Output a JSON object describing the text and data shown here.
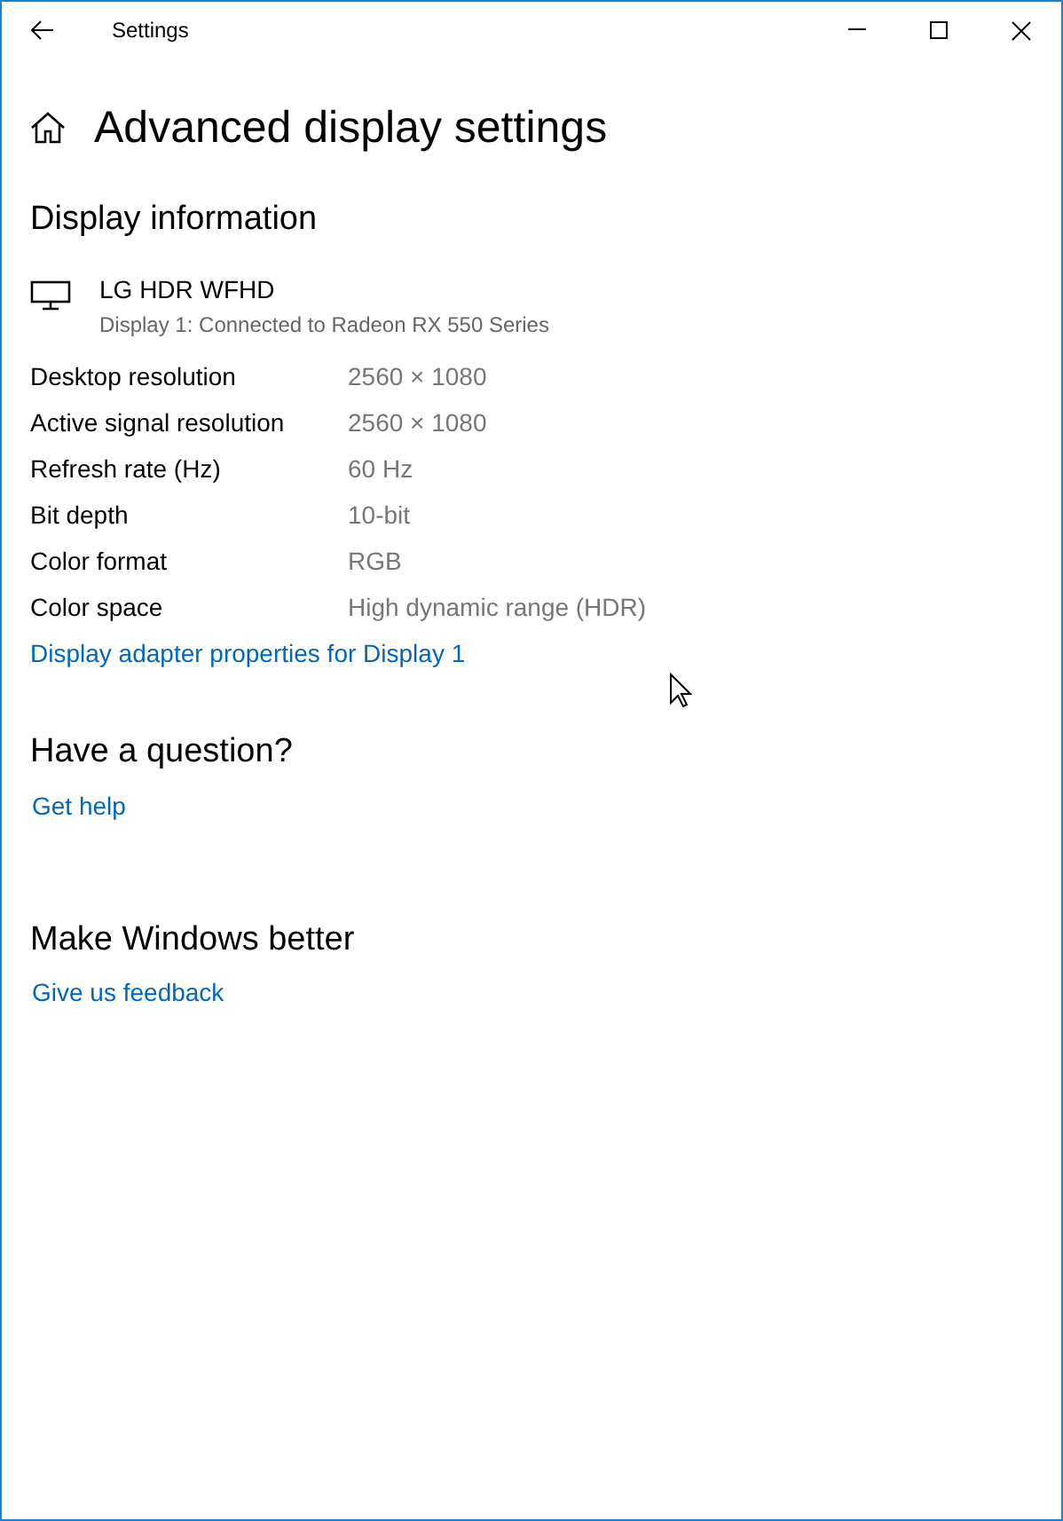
{
  "window": {
    "title": "Settings"
  },
  "page_title": "Advanced display settings",
  "display_information": {
    "heading": "Display information",
    "monitor_name": "LG HDR WFHD",
    "monitor_detail": "Display 1: Connected to Radeon RX 550 Series",
    "rows": [
      {
        "label": "Desktop resolution",
        "value": "2560 × 1080"
      },
      {
        "label": "Active signal resolution",
        "value": "2560 × 1080"
      },
      {
        "label": "Refresh rate (Hz)",
        "value": "60 Hz"
      },
      {
        "label": "Bit depth",
        "value": "10-bit"
      },
      {
        "label": "Color format",
        "value": "RGB"
      },
      {
        "label": "Color space",
        "value": "High dynamic range (HDR)"
      }
    ],
    "link": "Display adapter properties for Display 1"
  },
  "sections": [
    {
      "heading": "Have a question?",
      "link": "Get help"
    },
    {
      "heading": "Make Windows better",
      "link": "Give us feedback"
    }
  ]
}
